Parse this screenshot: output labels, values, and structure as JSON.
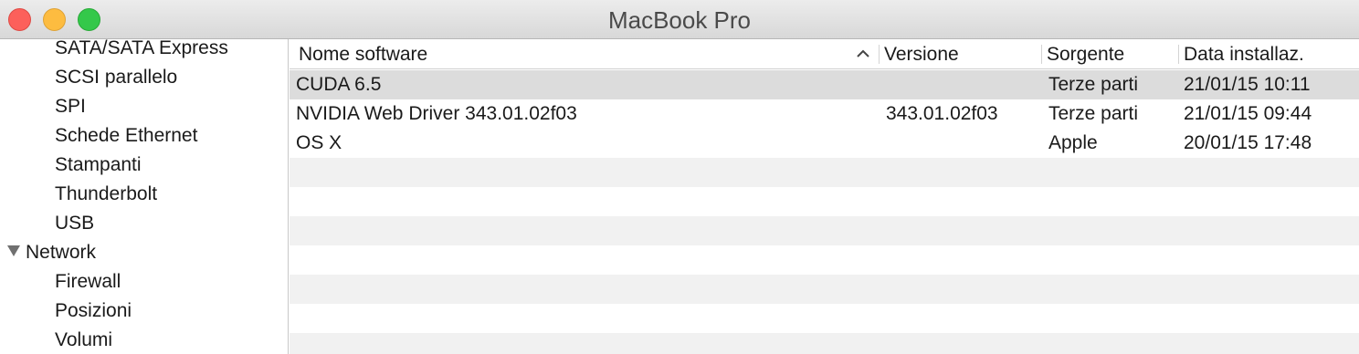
{
  "window": {
    "title": "MacBook Pro"
  },
  "sidebar": {
    "items": [
      {
        "label": "SATA/SATA Express",
        "level": 2
      },
      {
        "label": "SCSI parallelo",
        "level": 2
      },
      {
        "label": "SPI",
        "level": 2
      },
      {
        "label": "Schede Ethernet",
        "level": 2
      },
      {
        "label": "Stampanti",
        "level": 2
      },
      {
        "label": "Thunderbolt",
        "level": 2
      },
      {
        "label": "USB",
        "level": 2
      },
      {
        "label": "Network",
        "level": 1,
        "expanded": true
      },
      {
        "label": "Firewall",
        "level": 2
      },
      {
        "label": "Posizioni",
        "level": 2
      },
      {
        "label": "Volumi",
        "level": 2
      }
    ]
  },
  "table": {
    "columns": [
      "Nome software",
      "Versione",
      "Sorgente",
      "Data installaz."
    ],
    "sort_column": "Nome software",
    "sort_direction": "ascending",
    "rows": [
      [
        "CUDA 6.5",
        "",
        "Terze parti",
        "21/01/15 10:11"
      ],
      [
        "NVIDIA Web Driver 343.01.02f03",
        "343.01.02f03",
        "Terze parti",
        "21/01/15 09:44"
      ],
      [
        "OS X",
        "",
        "Apple",
        "20/01/15 17:48"
      ]
    ],
    "selected_row": 0
  },
  "colors": {
    "close": "#fc605b",
    "minimize": "#fdbc40",
    "zoom": "#34c84a",
    "selected_row": "#dcdcdc",
    "alt_row": "#f1f1f1"
  }
}
